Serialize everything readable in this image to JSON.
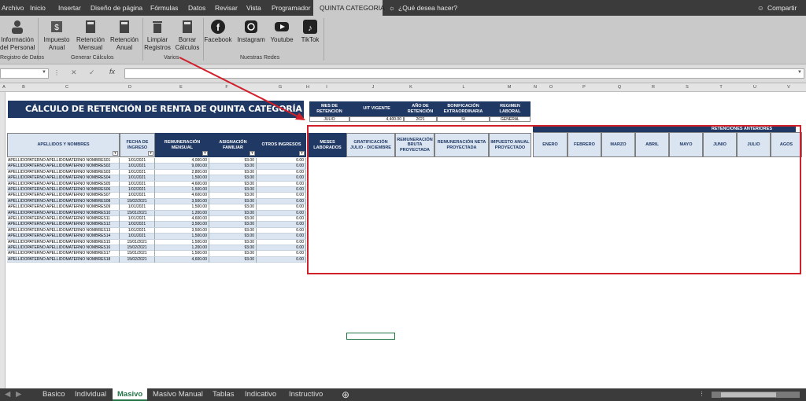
{
  "menu": {
    "items": [
      "Archivo",
      "Inicio",
      "Insertar",
      "Diseño de página",
      "Fórmulas",
      "Datos",
      "Revisar",
      "Vista",
      "Programador",
      "QUINTA CATEGORIA"
    ],
    "search": "¿Qué desea hacer?",
    "share": "Compartir"
  },
  "ribbon": {
    "b1": "Información\ndel Personal",
    "b2": "Impuesto\nAnual",
    "b3": "Retención\nMensual",
    "b4": "Retención\nAnual",
    "b5": "Limpiar\nRegistros",
    "b6": "Borrar\nCálculos",
    "b7": "Facebook",
    "b8": "Instagram",
    "b9": "Youtube",
    "b10": "TikTok",
    "g1": "Registro de Datos",
    "g2": "Generar Cálculos",
    "g3": "Varios",
    "g4": "Nuestras Redes"
  },
  "formula": {
    "fx": "fx"
  },
  "columns": [
    "A",
    "B",
    "C",
    "D",
    "E",
    "F",
    "G",
    "H",
    "I",
    "J",
    "K",
    "L",
    "M",
    "N",
    "O",
    "P",
    "Q",
    "R",
    "S",
    "T",
    "U",
    "V"
  ],
  "sheet": {
    "title": "CÁLCULO DE RETENCIÓN DE RENTA DE QUINTA CATEGORÍA",
    "params": {
      "h": [
        "MES DE RETENCION",
        "UIT VIGENTE",
        "AÑO DE RETENCIÓN",
        "BONIFICACIÓN EXTRAORDINARIA",
        "REGIMEN LABORAL"
      ],
      "v": [
        "JULIO",
        "4,400.00",
        "2021",
        "SI",
        "GENERAL"
      ]
    },
    "left_headers": [
      "APELLIDOS Y NOMBRES",
      "FECHA DE INGRESO",
      "REMUNERACIÓN MENSUAL",
      "ASIGNACIÓN FAMILIAR",
      "OTROS INGRESOS"
    ],
    "calc_headers": [
      "MESES LABORADOS",
      "GRATIFICACIÓN JULIO - DICIEMBRE",
      "REMUNERACIÓN BRUTA PROYECTADA",
      "REMUNERACIÓN NETA PROYECTADA",
      "IMPUESTO ANUAL PROYECTADO"
    ],
    "ret_title": "RETENCIONES ANTERIORES",
    "months": [
      "ENERO",
      "FEBRERO",
      "MARZO",
      "ABRIL",
      "MAYO",
      "JUNIO",
      "JULIO",
      "AGOS"
    ],
    "rows": [
      [
        "APELLIDOPATERNO APELLIDOMATERNO NOMBRES01",
        "1/01/2021",
        "4,000.00",
        "93.00",
        "0.00"
      ],
      [
        "APELLIDOPATERNO APELLIDOMATERNO NOMBRES02",
        "1/01/2021",
        "9,000.00",
        "93.00",
        "0.00"
      ],
      [
        "APELLIDOPATERNO APELLIDOMATERNO NOMBRES03",
        "1/01/2021",
        "2,800.00",
        "93.00",
        "0.00"
      ],
      [
        "APELLIDOPATERNO APELLIDOMATERNO NOMBRES04",
        "1/01/2021",
        "1,500.00",
        "93.00",
        "0.00"
      ],
      [
        "APELLIDOPATERNO APELLIDOMATERNO NOMBRES05",
        "1/01/2021",
        "4,600.00",
        "93.00",
        "0.00"
      ],
      [
        "APELLIDOPATERNO APELLIDOMATERNO NOMBRES06",
        "1/02/2021",
        "1,500.00",
        "93.00",
        "0.00"
      ],
      [
        "APELLIDOPATERNO APELLIDOMATERNO NOMBRES07",
        "1/02/2021",
        "4,600.00",
        "93.00",
        "0.00"
      ],
      [
        "APELLIDOPATERNO APELLIDOMATERNO NOMBRES08",
        "15/02/2021",
        "3,500.00",
        "93.00",
        "0.00"
      ],
      [
        "APELLIDOPATERNO APELLIDOMATERNO NOMBRES09",
        "1/01/2021",
        "1,500.00",
        "93.00",
        "0.00"
      ],
      [
        "APELLIDOPATERNO APELLIDOMATERNO NOMBRES10",
        "15/01/2021",
        "1,200.00",
        "93.00",
        "0.00"
      ],
      [
        "APELLIDOPATERNO APELLIDOMATERNO NOMBRES11",
        "1/01/2021",
        "4,600.00",
        "93.00",
        "0.00"
      ],
      [
        "APELLIDOPATERNO APELLIDOMATERNO NOMBRES12",
        "1/02/2021",
        "3,500.00",
        "93.00",
        "0.00"
      ],
      [
        "APELLIDOPATERNO APELLIDOMATERNO NOMBRES13",
        "1/01/2021",
        "3,500.00",
        "93.00",
        "0.00"
      ],
      [
        "APELLIDOPATERNO APELLIDOMATERNO NOMBRES14",
        "1/01/2021",
        "1,500.00",
        "93.00",
        "0.00"
      ],
      [
        "APELLIDOPATERNO APELLIDOMATERNO NOMBRES15",
        "15/01/2021",
        "1,500.00",
        "93.00",
        "0.00"
      ],
      [
        "APELLIDOPATERNO APELLIDOMATERNO NOMBRES16",
        "15/02/2021",
        "1,200.00",
        "93.00",
        "0.00"
      ],
      [
        "APELLIDOPATERNO APELLIDOMATERNO NOMBRES17",
        "15/01/2021",
        "1,500.00",
        "93.00",
        "0.00"
      ],
      [
        "APELLIDOPATERNO APELLIDOMATERNO NOMBRES18",
        "15/02/2021",
        "4,600.00",
        "93.00",
        "0.00"
      ]
    ]
  },
  "tabs": [
    "Basico",
    "Individual",
    "Masivo",
    "Masivo Manual",
    "Tablas",
    "Indicativo",
    "Instructivo"
  ],
  "colors": {
    "navy": "#1f3864",
    "header_light": "#dbe5f1",
    "excel_green": "#217346",
    "highlight_red": "#d0202a"
  }
}
